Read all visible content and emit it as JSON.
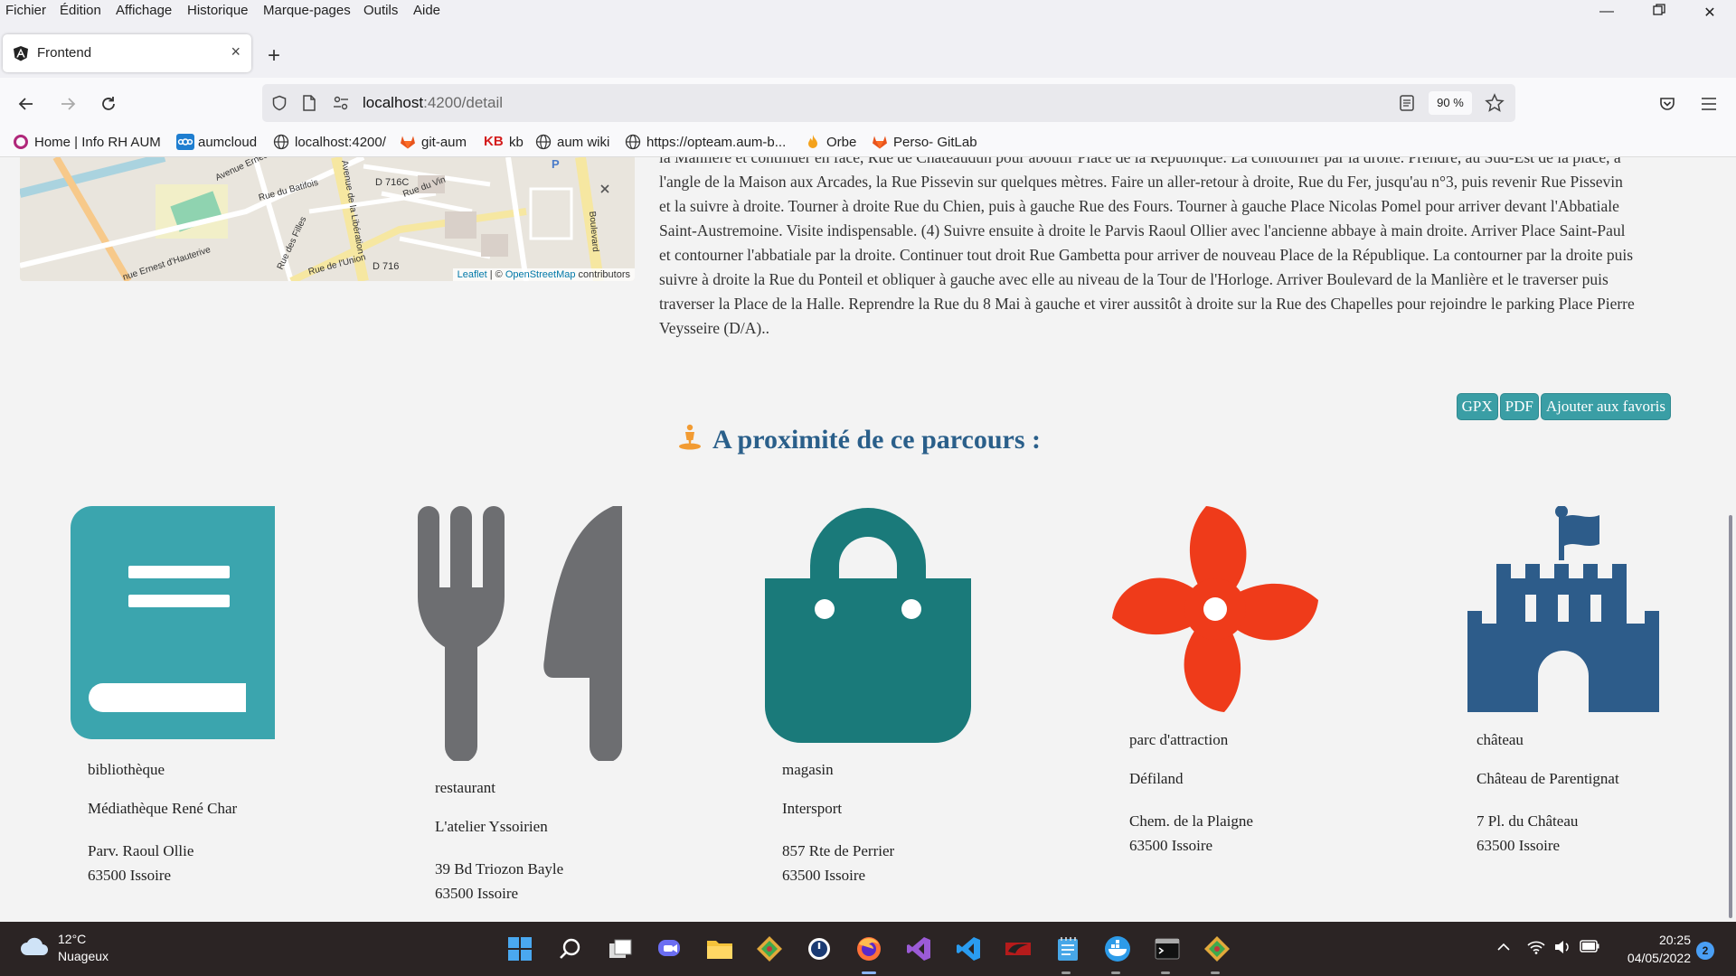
{
  "menubar": {
    "items": [
      "Fichier",
      "Édition",
      "Affichage",
      "Historique",
      "Marque-pages",
      "Outils",
      "Aide"
    ]
  },
  "tab": {
    "title": "Frontend"
  },
  "urlbar": {
    "host": "localhost",
    "path": ":4200/detail",
    "zoom": "90 %"
  },
  "bookmarks": [
    {
      "label": "Home | Info RH AUM",
      "icon": "ring-icon"
    },
    {
      "label": "aumcloud",
      "icon": "nextcloud-icon"
    },
    {
      "label": "localhost:4200/",
      "icon": "globe-icon"
    },
    {
      "label": "git-aum",
      "icon": "gitlab-icon"
    },
    {
      "label": "kb",
      "icon": "kb-icon"
    },
    {
      "label": "aum wiki",
      "icon": "globe-icon"
    },
    {
      "label": "https://opteam.aum-b...",
      "icon": "globe-icon"
    },
    {
      "label": "Orbe",
      "icon": "flame-icon"
    },
    {
      "label": "Perso- GitLab",
      "icon": "gitlab-icon"
    }
  ],
  "map": {
    "labels": [
      "Avenue Ernest d'Hauterive",
      "Rue du Batifois",
      "D 716C",
      "Rue du Vin",
      "Avenue de la Libération",
      "Boulevard",
      "nue Ernest d'Hauterive",
      "Rue de l'Union",
      "D 716",
      "Rue des Filles"
    ],
    "attribution_leaflet": "Leaflet",
    "attribution_sep": " | © ",
    "attribution_osm": "OpenStreetMap",
    "attribution_suffix": " contributors"
  },
  "description": {
    "lines": [
      "la Manlière et continuer en face, Rue de Chateaudun pour aboutir Place de la République. La contourner par la droite. Prendre, au Sud-Est de la place, à",
      "l'angle de la Maison aux Arcades, la Rue Pissevin sur quelques mètres. Faire un aller-retour à droite, Rue du Fer, jusqu'au n°3, puis revenir Rue Pissevin",
      "et la suivre à droite. Tourner à droite Rue du Chien, puis à gauche Rue des Fours. Tourner à gauche Place Nicolas Pomel pour arriver devant l'Abbatiale",
      "Saint-Austremoine. Visite indispensable. (4) Suivre ensuite à droite le Parvis Raoul Ollier avec l'ancienne abbaye à main droite. Arriver Place Saint-Paul",
      "et contourner l'abbatiale par la droite. Continuer tout droit Rue Gambetta pour arriver de nouveau Place de la République. La contourner par la droite puis",
      "suivre à droite la Rue du Ponteil et obliquer à gauche avec elle au niveau de la Tour de l'Horloge. Arriver Boulevard de la Manlière et le traverser puis",
      "traverser la Place de la Halle. Reprendre la Rue du 8 Mai à gauche et virer aussitôt à droite sur la Rue des Chapelles pour rejoindre le parking Place Pierre",
      "Veysseire (D/A).."
    ]
  },
  "actions": {
    "gpx": "GPX",
    "pdf": "PDF",
    "favorite": "Ajouter aux favoris"
  },
  "nearby": {
    "title": "A proximité de ce parcours :",
    "pois": [
      {
        "type": "bibliothèque",
        "name": "Médiathèque René Char",
        "address_line1": "Parv. Raoul Ollie",
        "address_line2": "63500 Issoire",
        "icon": "book-icon",
        "color": "#3ba5ae"
      },
      {
        "type": "restaurant",
        "name": "L'atelier Yssoirien",
        "address_line1": "39 Bd Triozon Bayle",
        "address_line2": "63500 Issoire",
        "icon": "fork-knife-icon",
        "color": "#6d6e71"
      },
      {
        "type": "magasin",
        "name": "Intersport",
        "address_line1": "857 Rte de Perrier",
        "address_line2": "63500 Issoire",
        "icon": "shopping-bag-icon",
        "color": "#1a7a7a"
      },
      {
        "type": "parc d'attraction",
        "name": "Défiland",
        "address_line1": "Chem. de la Plaigne",
        "address_line2": "63500 Issoire",
        "icon": "pinwheel-icon",
        "color": "#ef3b1a"
      },
      {
        "type": "château",
        "name": "Château de Parentignat",
        "address_line1": "7 Pl. du Château",
        "address_line2": "63500 Issoire",
        "icon": "castle-icon",
        "color": "#2d5c8a"
      }
    ]
  },
  "taskbar": {
    "weather_temp": "12°C",
    "weather_desc": "Nuageux",
    "time": "20:25",
    "date": "04/05/2022",
    "notifications": "2",
    "apps": [
      "windows-start-icon",
      "search-icon",
      "task-view-icon",
      "chat-icon",
      "file-explorer-icon",
      "gitkraken-icon",
      "timer-icon",
      "firefox-icon",
      "visual-studio-icon",
      "vscode-icon",
      "maven-icon",
      "notepad-icon",
      "docker-icon",
      "terminal-icon",
      "git-icon"
    ]
  },
  "colors": {
    "accent": "#3a9ea5",
    "title": "#2a5f8a",
    "taskbar": "#2b2424"
  }
}
